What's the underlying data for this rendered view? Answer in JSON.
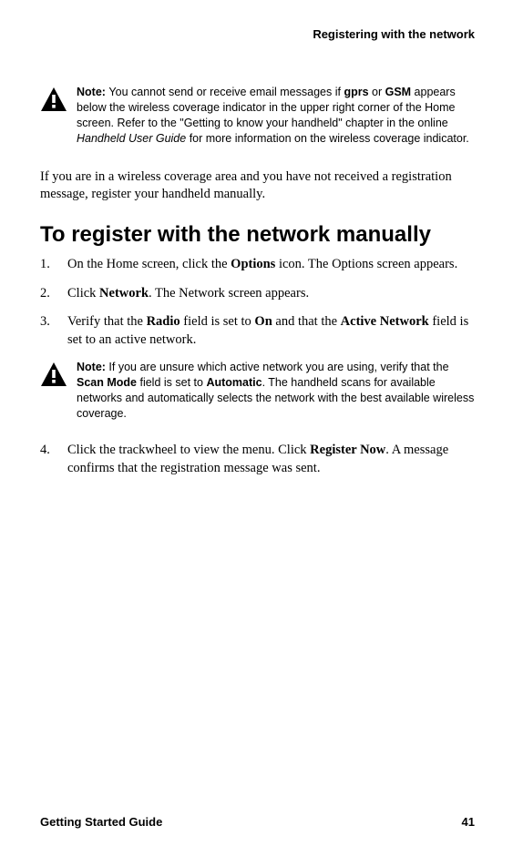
{
  "header": {
    "title": "Registering with the network"
  },
  "note1": {
    "label": "Note: ",
    "p1": "You cannot send or receive email messages if ",
    "b1": "gprs",
    "p2": " or ",
    "b2": "GSM",
    "p3": " appears below the wireless coverage indicator in the upper right corner of the Home screen. Refer to the \"Getting to know your handheld\" chapter in the online ",
    "i1": "Handheld User Guide",
    "p4": " for more information on the wireless coverage indicator."
  },
  "paragraph1": "If you are in a wireless coverage area and you have not received a registration message, register your handheld manually.",
  "heading": "To register with the network manually",
  "step1": {
    "p1": "On the Home screen, click the ",
    "b1": "Options",
    "p2": " icon. The Options screen appears."
  },
  "step2": {
    "p1": "Click ",
    "b1": "Network",
    "p2": ". The Network screen appears."
  },
  "step3": {
    "p1": "Verify that the ",
    "b1": "Radio",
    "p2": " field is set to ",
    "b2": "On",
    "p3": " and that the ",
    "b3": "Active Network",
    "p4": " field is set to an active network."
  },
  "note2": {
    "label": "Note: ",
    "p1": "If you are unsure which active network you are using, verify that the ",
    "b1": "Scan Mode",
    "p2": " field is set to ",
    "b2": "Automatic",
    "p3": ". The handheld scans for available networks and automatically selects the network with the best available wireless coverage."
  },
  "step4": {
    "p1": "Click the trackwheel to view the menu. Click ",
    "b1": "Register Now",
    "p2": ". A message confirms that the registration message was sent."
  },
  "footer": {
    "title": "Getting Started Guide",
    "page": "41"
  }
}
